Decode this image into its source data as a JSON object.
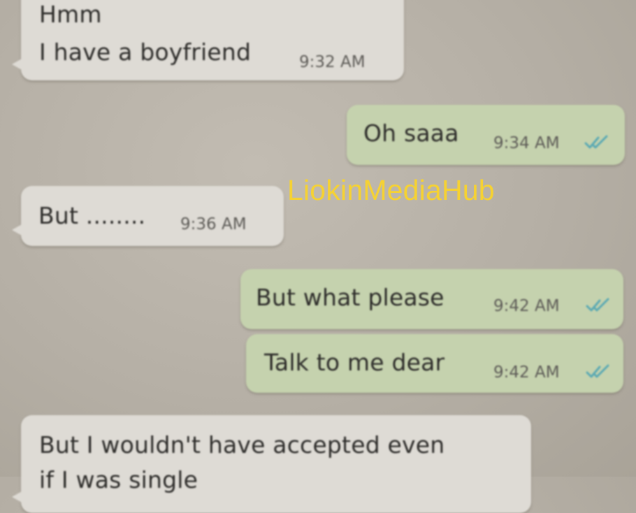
{
  "messages": [
    {
      "direction": "incoming",
      "lines": [
        "Hmm",
        "I have a boyfriend"
      ],
      "time": "9:32 AM"
    },
    {
      "direction": "outgoing",
      "lines": [
        "Oh saaa"
      ],
      "time": "9:34 AM",
      "read_status": "double-check-icon"
    },
    {
      "direction": "incoming",
      "lines": [
        "But ........"
      ],
      "time": "9:36 AM"
    },
    {
      "direction": "outgoing",
      "lines": [
        "But what please"
      ],
      "time": "9:42 AM",
      "read_status": "double-check-icon"
    },
    {
      "direction": "outgoing",
      "lines": [
        "Talk to me dear"
      ],
      "time": "9:42 AM",
      "read_status": "double-check-icon"
    },
    {
      "direction": "incoming",
      "lines": [
        "But I wouldn't have accepted even",
        "if I was single"
      ],
      "time": ""
    }
  ],
  "watermark": "LiokinMediaHub",
  "colors": {
    "background": "#b7b1a8",
    "incoming_bubble": "#dedbd5",
    "outgoing_bubble": "#c5d2ae",
    "read_ticks": "#5aa9b3",
    "watermark": "#f6d232"
  }
}
